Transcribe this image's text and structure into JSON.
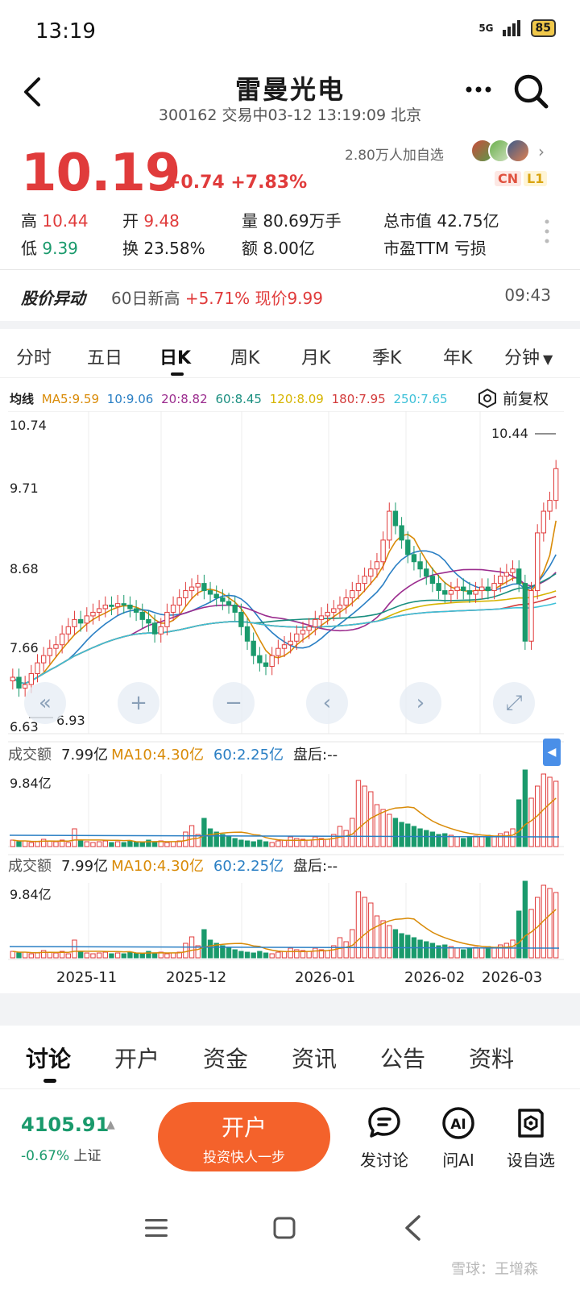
{
  "status_bar": {
    "time": "13:19",
    "network": "5G",
    "battery": "85"
  },
  "header": {
    "stock_name": "雷曼光电",
    "subtitle": "300162 交易中03-12 13:19:09 北京"
  },
  "quote": {
    "price": "10.19",
    "change": "+0.74 +7.83%",
    "watchers": "2.80万人加自选",
    "badges": [
      "CN",
      "L1"
    ],
    "fields": {
      "high_label": "高",
      "high": "10.44",
      "open_label": "开",
      "open": "9.48",
      "volume_label": "量",
      "volume": "80.69万手",
      "mktcap_label": "总市值",
      "mktcap": "42.75亿",
      "low_label": "低",
      "low": "9.39",
      "turnover_label": "换",
      "turnover": "23.58%",
      "amount_label": "额",
      "amount": "8.00亿",
      "pe_label": "市盈TTM",
      "pe": "亏损"
    }
  },
  "alert": {
    "title": "股价异动",
    "text_prefix": "60日新高",
    "text_red": "+5.71% 现价9.99",
    "time": "09:43"
  },
  "period_tabs": [
    "分时",
    "五日",
    "日K",
    "周K",
    "月K",
    "季K",
    "年K",
    "分钟"
  ],
  "active_period": "日K",
  "ma_legend": {
    "label": "均线",
    "items": [
      {
        "text": "MA5:9.59",
        "color": "#d98b08"
      },
      {
        "text": "10:9.06",
        "color": "#2a7fc4"
      },
      {
        "text": "20:8.82",
        "color": "#9b2c8e"
      },
      {
        "text": "60:8.45",
        "color": "#1a8f80"
      },
      {
        "text": "120:8.09",
        "color": "#d6b400"
      },
      {
        "text": "180:7.95",
        "color": "#d33b3b"
      },
      {
        "text": "250:7.65",
        "color": "#3cc0d8"
      }
    ],
    "adjust_label": "前复权"
  },
  "chart_data": {
    "type": "candlestick",
    "y_axis_labels": [
      "10.74",
      "9.71",
      "8.68",
      "7.66",
      "6.63"
    ],
    "ylim": [
      6.63,
      10.74
    ],
    "high_marker": "10.44",
    "low_marker": "6.93",
    "x_axis_labels": [
      "2025-11",
      "2025-12",
      "2026-01",
      "2026-02",
      "2026-03"
    ],
    "close_series": [
      7.3,
      7.15,
      7.2,
      7.35,
      7.5,
      7.6,
      7.7,
      7.75,
      7.9,
      8.0,
      8.1,
      8.05,
      8.15,
      8.2,
      8.25,
      8.3,
      8.28,
      8.32,
      8.3,
      8.25,
      8.2,
      8.1,
      8.05,
      7.9,
      8.0,
      8.2,
      8.3,
      8.4,
      8.5,
      8.55,
      8.6,
      8.5,
      8.45,
      8.4,
      8.35,
      8.3,
      8.2,
      8.0,
      7.8,
      7.6,
      7.5,
      7.45,
      7.6,
      7.7,
      7.75,
      7.8,
      7.9,
      7.95,
      8.0,
      8.1,
      8.15,
      8.2,
      8.25,
      8.3,
      8.4,
      8.5,
      8.6,
      8.7,
      8.8,
      8.9,
      9.2,
      9.6,
      9.4,
      9.2,
      9.0,
      8.9,
      8.8,
      8.7,
      8.6,
      8.5,
      8.45,
      8.5,
      8.55,
      8.5,
      8.45,
      8.5,
      8.55,
      8.5,
      8.6,
      8.7,
      8.75,
      8.8,
      8.6,
      7.8,
      8.5,
      9.3,
      9.6,
      9.75,
      10.19
    ],
    "volume": {
      "header_label": "成交额",
      "value": "7.99亿",
      "ma10": "MA10:4.30亿",
      "ma60": "60:2.25亿",
      "after_hours": "盘后:--",
      "max_label": "9.84亿",
      "bars": [
        0.08,
        0.06,
        0.07,
        0.05,
        0.06,
        0.09,
        0.07,
        0.06,
        0.08,
        0.05,
        0.22,
        0.07,
        0.06,
        0.05,
        0.06,
        0.07,
        0.05,
        0.06,
        0.05,
        0.07,
        0.06,
        0.05,
        0.08,
        0.06,
        0.07,
        0.05,
        0.06,
        0.07,
        0.18,
        0.26,
        0.15,
        0.35,
        0.22,
        0.18,
        0.15,
        0.12,
        0.1,
        0.08,
        0.07,
        0.06,
        0.08,
        0.06,
        0.05,
        0.07,
        0.08,
        0.12,
        0.1,
        0.09,
        0.08,
        0.12,
        0.1,
        0.09,
        0.15,
        0.25,
        0.2,
        0.35,
        0.82,
        0.75,
        0.68,
        0.52,
        0.46,
        0.4,
        0.35,
        0.3,
        0.28,
        0.25,
        0.22,
        0.2,
        0.18,
        0.15,
        0.16,
        0.14,
        0.12,
        0.1,
        0.12,
        0.13,
        0.12,
        0.14,
        0.12,
        0.16,
        0.18,
        0.22,
        0.58,
        0.95,
        0.6,
        0.75,
        0.9,
        0.86,
        0.81
      ]
    }
  },
  "content_tabs": [
    "讨论",
    "开户",
    "资金",
    "资讯",
    "公告",
    "资料"
  ],
  "active_content_tab": "讨论",
  "index": {
    "value": "4105.91",
    "change": "-0.67%",
    "name": "上证"
  },
  "open_account": {
    "title": "开户",
    "subtitle": "投资快人一步"
  },
  "actions": [
    {
      "label": "发讨论",
      "icon": "discuss-icon"
    },
    {
      "label": "问AI",
      "icon": "ai-icon"
    },
    {
      "label": "设自选",
      "icon": "add-watchlist-icon"
    }
  ],
  "watermark": "雪球：王增森"
}
